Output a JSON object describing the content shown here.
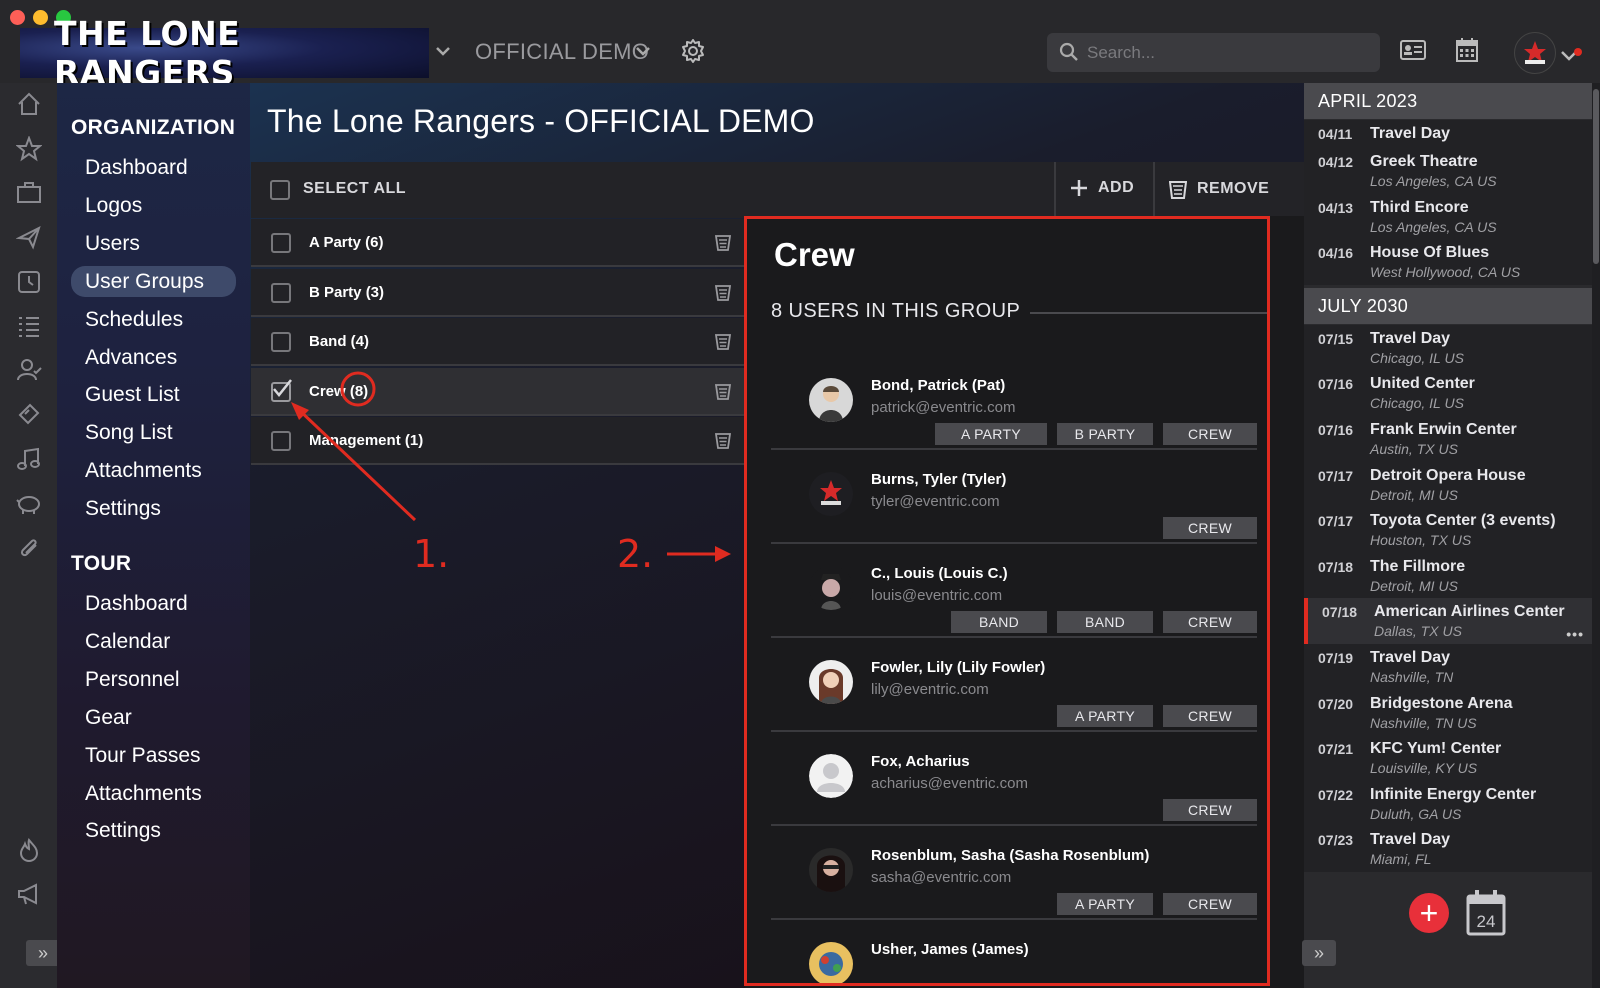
{
  "app": {
    "logo_text": "THE LONE RANGERS",
    "tour_selector": "OFFICIAL DEMO",
    "search_placeholder": "Search...",
    "colors": {
      "accent_red": "#e02b20",
      "fab_red": "#e8303a",
      "nav_active": "#3e4a6a"
    }
  },
  "nav": {
    "org_heading": "ORGANIZATION",
    "org_items": [
      "Dashboard",
      "Logos",
      "Users",
      "User Groups",
      "Schedules",
      "Advances",
      "Guest List",
      "Song List",
      "Attachments",
      "Settings"
    ],
    "org_active": "User Groups",
    "tour_heading": "TOUR",
    "tour_items": [
      "Dashboard",
      "Calendar",
      "Personnel",
      "Gear",
      "Tour Passes",
      "Attachments",
      "Settings"
    ]
  },
  "rail_icons": [
    "home-icon",
    "star-icon",
    "briefcase-icon",
    "plane-icon",
    "clock-icon",
    "list-icon",
    "person-icon",
    "ticket-icon",
    "music-icon",
    "piggy-bank-icon",
    "paperclip-icon",
    "flame-icon",
    "megaphone-icon"
  ],
  "main": {
    "title": "The Lone Rangers - OFFICIAL DEMO",
    "select_all": "SELECT ALL",
    "add": "ADD",
    "remove": "REMOVE",
    "groups": [
      {
        "name": "A Party (6)",
        "checked": false
      },
      {
        "name": "B Party (3)",
        "checked": false
      },
      {
        "name": "Band (4)",
        "checked": false
      },
      {
        "name": "Crew (8)",
        "checked": true
      },
      {
        "name": "Management (1)",
        "checked": false
      }
    ]
  },
  "detail": {
    "title": "Crew",
    "count_label": "8 USERS IN THIS GROUP",
    "users": [
      {
        "name": "Bond, Patrick (Pat)",
        "email": "patrick@eventric.com",
        "tags": [
          "A PARTY",
          "B PARTY",
          "CREW"
        ]
      },
      {
        "name": "Burns, Tyler (Tyler)",
        "email": "tyler@eventric.com",
        "tags": [
          "CREW"
        ]
      },
      {
        "name": "C., Louis (Louis C.)",
        "email": "louis@eventric.com",
        "tags": [
          "BAND",
          "BAND",
          "CREW"
        ]
      },
      {
        "name": "Fowler, Lily (Lily Fowler)",
        "email": "lily@eventric.com",
        "tags": [
          "A PARTY",
          "CREW"
        ]
      },
      {
        "name": "Fox, Acharius",
        "email": "acharius@eventric.com",
        "tags": [
          "CREW"
        ]
      },
      {
        "name": "Rosenblum, Sasha (Sasha Rosenblum)",
        "email": "sasha@eventric.com",
        "tags": [
          "A PARTY",
          "CREW"
        ]
      },
      {
        "name": "Usher, James (James)",
        "email": "",
        "tags": []
      }
    ]
  },
  "annotations": {
    "step1": "1.",
    "step2": "2."
  },
  "calendar": {
    "months": [
      {
        "label": "APRIL 2023",
        "events": [
          {
            "date": "04/11",
            "title": "Travel Day",
            "location": ""
          },
          {
            "date": "04/12",
            "title": "Greek Theatre",
            "location": "Los Angeles, CA US"
          },
          {
            "date": "04/13",
            "title": "Third Encore",
            "location": "Los Angeles, CA US"
          },
          {
            "date": "04/16",
            "title": "House Of Blues",
            "location": "West Hollywood, CA US"
          }
        ]
      },
      {
        "label": "JULY 2030",
        "events": [
          {
            "date": "07/15",
            "title": "Travel Day",
            "location": "Chicago, IL US"
          },
          {
            "date": "07/16",
            "title": "United Center",
            "location": "Chicago, IL US"
          },
          {
            "date": "07/16",
            "title": "Frank Erwin Center",
            "location": "Austin, TX US"
          },
          {
            "date": "07/17",
            "title": "Detroit Opera House",
            "location": "Detroit, MI US"
          },
          {
            "date": "07/17",
            "title": "Toyota Center (3 events)",
            "location": "Houston, TX US"
          },
          {
            "date": "07/18",
            "title": "The Fillmore",
            "location": "Detroit, MI US"
          },
          {
            "date": "07/18",
            "title": "American Airlines Center",
            "location": "Dallas, TX US",
            "active": true
          },
          {
            "date": "07/19",
            "title": "Travel Day",
            "location": "Nashville, TN"
          },
          {
            "date": "07/20",
            "title": "Bridgestone Arena",
            "location": "Nashville, TN US"
          },
          {
            "date": "07/21",
            "title": "KFC Yum! Center",
            "location": "Louisville, KY US"
          },
          {
            "date": "07/22",
            "title": "Infinite Energy Center",
            "location": "Duluth, GA US"
          },
          {
            "date": "07/23",
            "title": "Travel Day",
            "location": "Miami, FL"
          }
        ]
      }
    ],
    "more": "•••",
    "calendar_day": "24"
  }
}
